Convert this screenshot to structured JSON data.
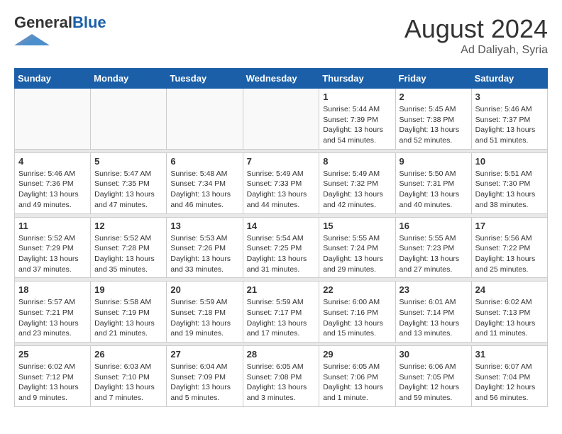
{
  "logo": {
    "general": "General",
    "blue": "Blue"
  },
  "header": {
    "month": "August 2024",
    "location": "Ad Daliyah, Syria"
  },
  "weekdays": [
    "Sunday",
    "Monday",
    "Tuesday",
    "Wednesday",
    "Thursday",
    "Friday",
    "Saturday"
  ],
  "weeks": [
    [
      {
        "day": "",
        "info": ""
      },
      {
        "day": "",
        "info": ""
      },
      {
        "day": "",
        "info": ""
      },
      {
        "day": "",
        "info": ""
      },
      {
        "day": "1",
        "info": "Sunrise: 5:44 AM\nSunset: 7:39 PM\nDaylight: 13 hours\nand 54 minutes."
      },
      {
        "day": "2",
        "info": "Sunrise: 5:45 AM\nSunset: 7:38 PM\nDaylight: 13 hours\nand 52 minutes."
      },
      {
        "day": "3",
        "info": "Sunrise: 5:46 AM\nSunset: 7:37 PM\nDaylight: 13 hours\nand 51 minutes."
      }
    ],
    [
      {
        "day": "4",
        "info": "Sunrise: 5:46 AM\nSunset: 7:36 PM\nDaylight: 13 hours\nand 49 minutes."
      },
      {
        "day": "5",
        "info": "Sunrise: 5:47 AM\nSunset: 7:35 PM\nDaylight: 13 hours\nand 47 minutes."
      },
      {
        "day": "6",
        "info": "Sunrise: 5:48 AM\nSunset: 7:34 PM\nDaylight: 13 hours\nand 46 minutes."
      },
      {
        "day": "7",
        "info": "Sunrise: 5:49 AM\nSunset: 7:33 PM\nDaylight: 13 hours\nand 44 minutes."
      },
      {
        "day": "8",
        "info": "Sunrise: 5:49 AM\nSunset: 7:32 PM\nDaylight: 13 hours\nand 42 minutes."
      },
      {
        "day": "9",
        "info": "Sunrise: 5:50 AM\nSunset: 7:31 PM\nDaylight: 13 hours\nand 40 minutes."
      },
      {
        "day": "10",
        "info": "Sunrise: 5:51 AM\nSunset: 7:30 PM\nDaylight: 13 hours\nand 38 minutes."
      }
    ],
    [
      {
        "day": "11",
        "info": "Sunrise: 5:52 AM\nSunset: 7:29 PM\nDaylight: 13 hours\nand 37 minutes."
      },
      {
        "day": "12",
        "info": "Sunrise: 5:52 AM\nSunset: 7:28 PM\nDaylight: 13 hours\nand 35 minutes."
      },
      {
        "day": "13",
        "info": "Sunrise: 5:53 AM\nSunset: 7:26 PM\nDaylight: 13 hours\nand 33 minutes."
      },
      {
        "day": "14",
        "info": "Sunrise: 5:54 AM\nSunset: 7:25 PM\nDaylight: 13 hours\nand 31 minutes."
      },
      {
        "day": "15",
        "info": "Sunrise: 5:55 AM\nSunset: 7:24 PM\nDaylight: 13 hours\nand 29 minutes."
      },
      {
        "day": "16",
        "info": "Sunrise: 5:55 AM\nSunset: 7:23 PM\nDaylight: 13 hours\nand 27 minutes."
      },
      {
        "day": "17",
        "info": "Sunrise: 5:56 AM\nSunset: 7:22 PM\nDaylight: 13 hours\nand 25 minutes."
      }
    ],
    [
      {
        "day": "18",
        "info": "Sunrise: 5:57 AM\nSunset: 7:21 PM\nDaylight: 13 hours\nand 23 minutes."
      },
      {
        "day": "19",
        "info": "Sunrise: 5:58 AM\nSunset: 7:19 PM\nDaylight: 13 hours\nand 21 minutes."
      },
      {
        "day": "20",
        "info": "Sunrise: 5:59 AM\nSunset: 7:18 PM\nDaylight: 13 hours\nand 19 minutes."
      },
      {
        "day": "21",
        "info": "Sunrise: 5:59 AM\nSunset: 7:17 PM\nDaylight: 13 hours\nand 17 minutes."
      },
      {
        "day": "22",
        "info": "Sunrise: 6:00 AM\nSunset: 7:16 PM\nDaylight: 13 hours\nand 15 minutes."
      },
      {
        "day": "23",
        "info": "Sunrise: 6:01 AM\nSunset: 7:14 PM\nDaylight: 13 hours\nand 13 minutes."
      },
      {
        "day": "24",
        "info": "Sunrise: 6:02 AM\nSunset: 7:13 PM\nDaylight: 13 hours\nand 11 minutes."
      }
    ],
    [
      {
        "day": "25",
        "info": "Sunrise: 6:02 AM\nSunset: 7:12 PM\nDaylight: 13 hours\nand 9 minutes."
      },
      {
        "day": "26",
        "info": "Sunrise: 6:03 AM\nSunset: 7:10 PM\nDaylight: 13 hours\nand 7 minutes."
      },
      {
        "day": "27",
        "info": "Sunrise: 6:04 AM\nSunset: 7:09 PM\nDaylight: 13 hours\nand 5 minutes."
      },
      {
        "day": "28",
        "info": "Sunrise: 6:05 AM\nSunset: 7:08 PM\nDaylight: 13 hours\nand 3 minutes."
      },
      {
        "day": "29",
        "info": "Sunrise: 6:05 AM\nSunset: 7:06 PM\nDaylight: 13 hours\nand 1 minute."
      },
      {
        "day": "30",
        "info": "Sunrise: 6:06 AM\nSunset: 7:05 PM\nDaylight: 12 hours\nand 59 minutes."
      },
      {
        "day": "31",
        "info": "Sunrise: 6:07 AM\nSunset: 7:04 PM\nDaylight: 12 hours\nand 56 minutes."
      }
    ]
  ]
}
